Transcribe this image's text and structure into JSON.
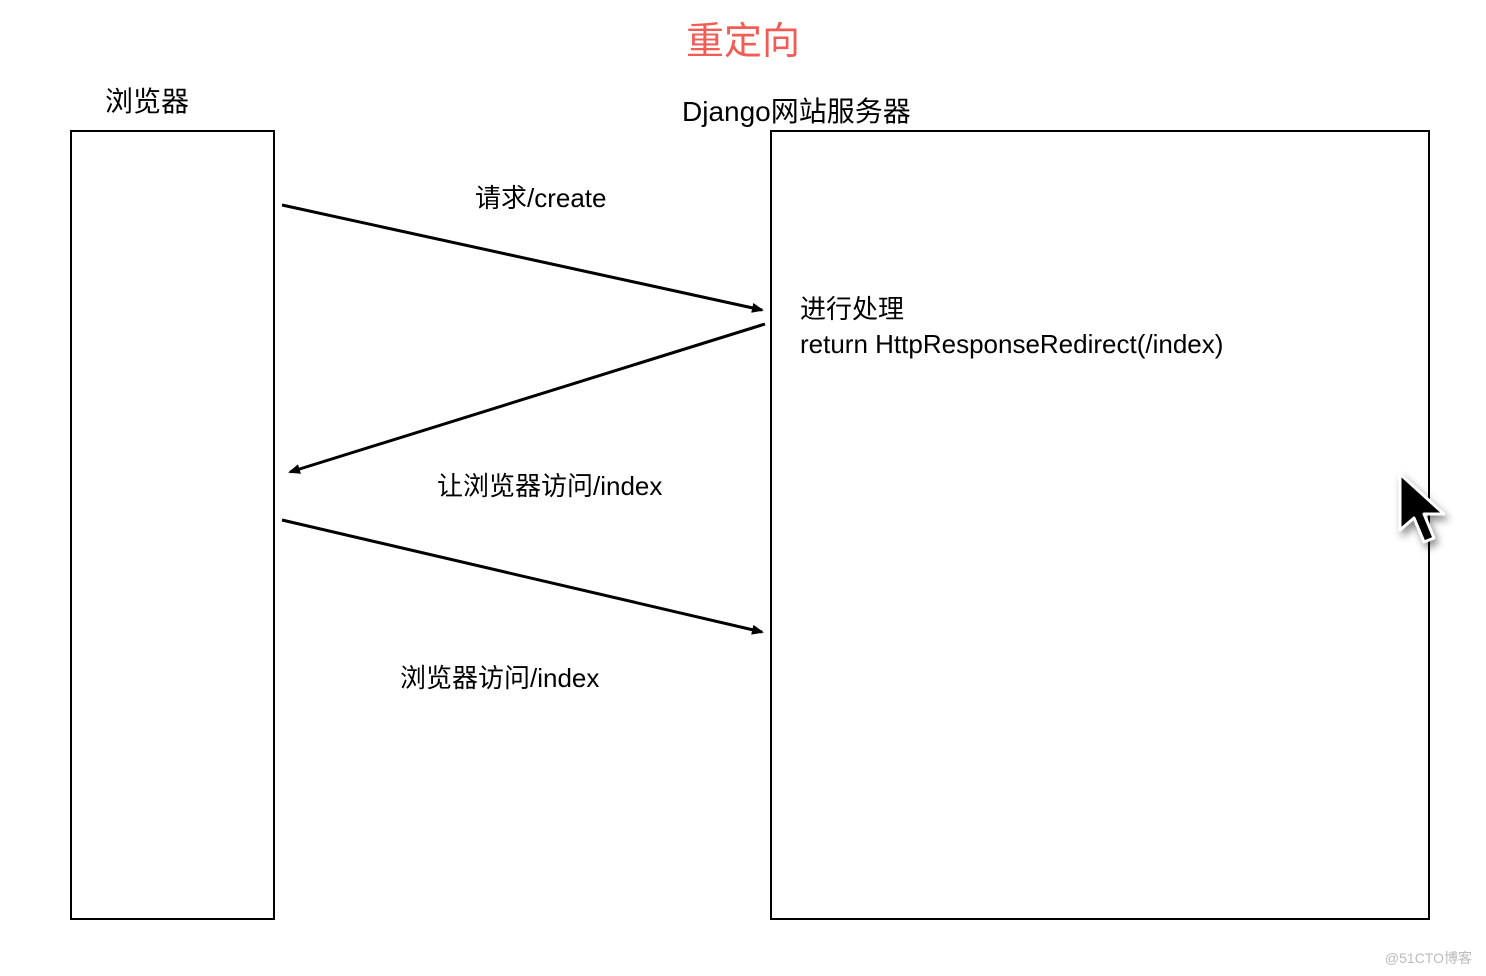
{
  "title": "重定向",
  "browser_label": "浏览器",
  "server_label": "Django网站服务器",
  "messages": {
    "request_create": "请求/create",
    "redirect_index": "让浏览器访问/index",
    "access_index": "浏览器访问/index"
  },
  "server": {
    "processing": "进行处理",
    "response": "return HttpResponseRedirect(/index)"
  },
  "watermark": "@51CTO博客"
}
